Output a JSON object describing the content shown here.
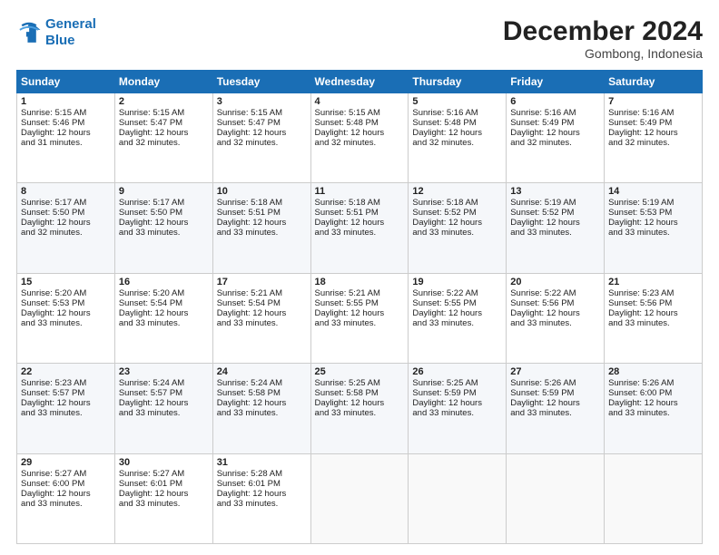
{
  "header": {
    "logo_line1": "General",
    "logo_line2": "Blue",
    "month": "December 2024",
    "location": "Gombong, Indonesia"
  },
  "weekdays": [
    "Sunday",
    "Monday",
    "Tuesday",
    "Wednesday",
    "Thursday",
    "Friday",
    "Saturday"
  ],
  "weeks": [
    [
      {
        "day": "1",
        "lines": [
          "Sunrise: 5:15 AM",
          "Sunset: 5:46 PM",
          "Daylight: 12 hours",
          "and 31 minutes."
        ]
      },
      {
        "day": "2",
        "lines": [
          "Sunrise: 5:15 AM",
          "Sunset: 5:47 PM",
          "Daylight: 12 hours",
          "and 32 minutes."
        ]
      },
      {
        "day": "3",
        "lines": [
          "Sunrise: 5:15 AM",
          "Sunset: 5:47 PM",
          "Daylight: 12 hours",
          "and 32 minutes."
        ]
      },
      {
        "day": "4",
        "lines": [
          "Sunrise: 5:15 AM",
          "Sunset: 5:48 PM",
          "Daylight: 12 hours",
          "and 32 minutes."
        ]
      },
      {
        "day": "5",
        "lines": [
          "Sunrise: 5:16 AM",
          "Sunset: 5:48 PM",
          "Daylight: 12 hours",
          "and 32 minutes."
        ]
      },
      {
        "day": "6",
        "lines": [
          "Sunrise: 5:16 AM",
          "Sunset: 5:49 PM",
          "Daylight: 12 hours",
          "and 32 minutes."
        ]
      },
      {
        "day": "7",
        "lines": [
          "Sunrise: 5:16 AM",
          "Sunset: 5:49 PM",
          "Daylight: 12 hours",
          "and 32 minutes."
        ]
      }
    ],
    [
      {
        "day": "8",
        "lines": [
          "Sunrise: 5:17 AM",
          "Sunset: 5:50 PM",
          "Daylight: 12 hours",
          "and 32 minutes."
        ]
      },
      {
        "day": "9",
        "lines": [
          "Sunrise: 5:17 AM",
          "Sunset: 5:50 PM",
          "Daylight: 12 hours",
          "and 33 minutes."
        ]
      },
      {
        "day": "10",
        "lines": [
          "Sunrise: 5:18 AM",
          "Sunset: 5:51 PM",
          "Daylight: 12 hours",
          "and 33 minutes."
        ]
      },
      {
        "day": "11",
        "lines": [
          "Sunrise: 5:18 AM",
          "Sunset: 5:51 PM",
          "Daylight: 12 hours",
          "and 33 minutes."
        ]
      },
      {
        "day": "12",
        "lines": [
          "Sunrise: 5:18 AM",
          "Sunset: 5:52 PM",
          "Daylight: 12 hours",
          "and 33 minutes."
        ]
      },
      {
        "day": "13",
        "lines": [
          "Sunrise: 5:19 AM",
          "Sunset: 5:52 PM",
          "Daylight: 12 hours",
          "and 33 minutes."
        ]
      },
      {
        "day": "14",
        "lines": [
          "Sunrise: 5:19 AM",
          "Sunset: 5:53 PM",
          "Daylight: 12 hours",
          "and 33 minutes."
        ]
      }
    ],
    [
      {
        "day": "15",
        "lines": [
          "Sunrise: 5:20 AM",
          "Sunset: 5:53 PM",
          "Daylight: 12 hours",
          "and 33 minutes."
        ]
      },
      {
        "day": "16",
        "lines": [
          "Sunrise: 5:20 AM",
          "Sunset: 5:54 PM",
          "Daylight: 12 hours",
          "and 33 minutes."
        ]
      },
      {
        "day": "17",
        "lines": [
          "Sunrise: 5:21 AM",
          "Sunset: 5:54 PM",
          "Daylight: 12 hours",
          "and 33 minutes."
        ]
      },
      {
        "day": "18",
        "lines": [
          "Sunrise: 5:21 AM",
          "Sunset: 5:55 PM",
          "Daylight: 12 hours",
          "and 33 minutes."
        ]
      },
      {
        "day": "19",
        "lines": [
          "Sunrise: 5:22 AM",
          "Sunset: 5:55 PM",
          "Daylight: 12 hours",
          "and 33 minutes."
        ]
      },
      {
        "day": "20",
        "lines": [
          "Sunrise: 5:22 AM",
          "Sunset: 5:56 PM",
          "Daylight: 12 hours",
          "and 33 minutes."
        ]
      },
      {
        "day": "21",
        "lines": [
          "Sunrise: 5:23 AM",
          "Sunset: 5:56 PM",
          "Daylight: 12 hours",
          "and 33 minutes."
        ]
      }
    ],
    [
      {
        "day": "22",
        "lines": [
          "Sunrise: 5:23 AM",
          "Sunset: 5:57 PM",
          "Daylight: 12 hours",
          "and 33 minutes."
        ]
      },
      {
        "day": "23",
        "lines": [
          "Sunrise: 5:24 AM",
          "Sunset: 5:57 PM",
          "Daylight: 12 hours",
          "and 33 minutes."
        ]
      },
      {
        "day": "24",
        "lines": [
          "Sunrise: 5:24 AM",
          "Sunset: 5:58 PM",
          "Daylight: 12 hours",
          "and 33 minutes."
        ]
      },
      {
        "day": "25",
        "lines": [
          "Sunrise: 5:25 AM",
          "Sunset: 5:58 PM",
          "Daylight: 12 hours",
          "and 33 minutes."
        ]
      },
      {
        "day": "26",
        "lines": [
          "Sunrise: 5:25 AM",
          "Sunset: 5:59 PM",
          "Daylight: 12 hours",
          "and 33 minutes."
        ]
      },
      {
        "day": "27",
        "lines": [
          "Sunrise: 5:26 AM",
          "Sunset: 5:59 PM",
          "Daylight: 12 hours",
          "and 33 minutes."
        ]
      },
      {
        "day": "28",
        "lines": [
          "Sunrise: 5:26 AM",
          "Sunset: 6:00 PM",
          "Daylight: 12 hours",
          "and 33 minutes."
        ]
      }
    ],
    [
      {
        "day": "29",
        "lines": [
          "Sunrise: 5:27 AM",
          "Sunset: 6:00 PM",
          "Daylight: 12 hours",
          "and 33 minutes."
        ]
      },
      {
        "day": "30",
        "lines": [
          "Sunrise: 5:27 AM",
          "Sunset: 6:01 PM",
          "Daylight: 12 hours",
          "and 33 minutes."
        ]
      },
      {
        "day": "31",
        "lines": [
          "Sunrise: 5:28 AM",
          "Sunset: 6:01 PM",
          "Daylight: 12 hours",
          "and 33 minutes."
        ]
      },
      null,
      null,
      null,
      null
    ]
  ]
}
